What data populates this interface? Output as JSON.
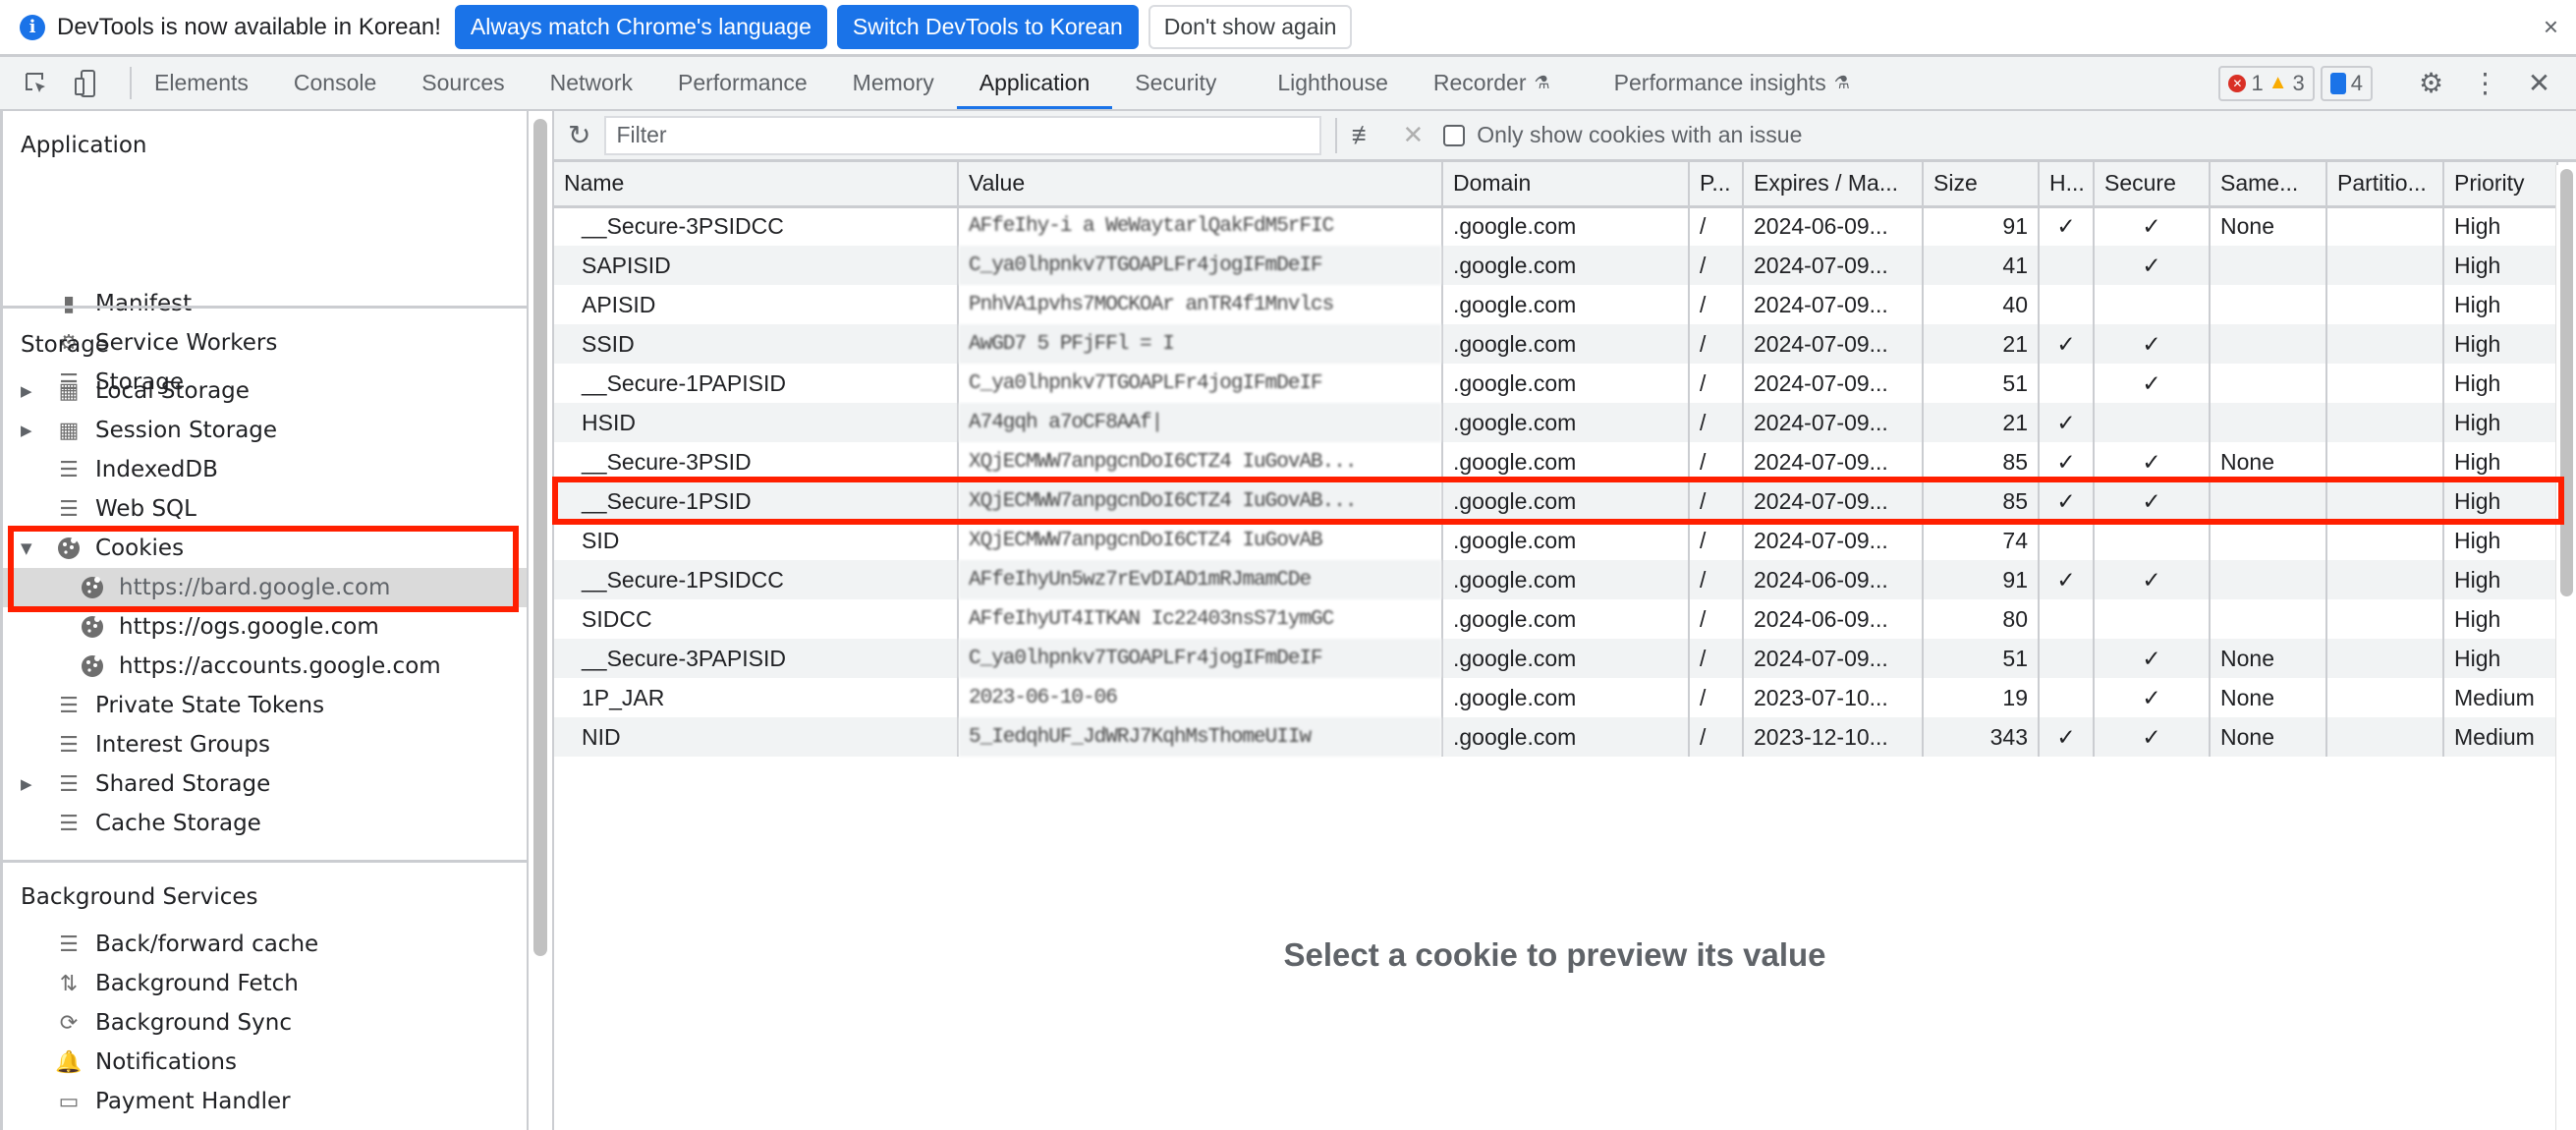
{
  "infobar": {
    "icon": "info-icon",
    "message": "DevTools is now available in Korean!",
    "buttons": [
      "Always match Chrome's language",
      "Switch DevTools to Korean",
      "Don't show again"
    ],
    "close": "×"
  },
  "tabs": [
    "Elements",
    "Console",
    "Sources",
    "Network",
    "Performance",
    "Memory",
    "Application",
    "Security",
    "Lighthouse",
    "Recorder",
    "Performance insights"
  ],
  "active_tab": "Application",
  "issues": {
    "errors": "1",
    "warnings": "3",
    "messages": "4"
  },
  "sidebar": {
    "application_heading": "Application",
    "application_items": [
      "Manifest",
      "Service Workers",
      "Storage"
    ],
    "storage_heading": "Storage",
    "storage_items": [
      "Local Storage",
      "Session Storage",
      "IndexedDB",
      "Web SQL",
      "Cookies",
      "https://bard.google.com",
      "https://ogs.google.com",
      "https://accounts.google.com",
      "Private State Tokens",
      "Interest Groups",
      "Shared Storage",
      "Cache Storage"
    ],
    "background_heading": "Background Services",
    "background_items": [
      "Back/forward cache",
      "Background Fetch",
      "Background Sync",
      "Notifications",
      "Payment Handler"
    ],
    "selected": "https://bard.google.com"
  },
  "toolbar": {
    "filter_placeholder": "Filter",
    "only_issues_label": "Only show cookies with an issue",
    "only_issues_checked": false
  },
  "table": {
    "columns": [
      "Name",
      "Value",
      "Domain",
      "P...",
      "Expires / Ma...",
      "Size",
      "H...",
      "Secure",
      "Same...",
      "Partitio...",
      "Priority"
    ],
    "rows": [
      [
        "__Secure-3PSIDCC",
        "AFfeIhy-i a WeWaytarlQakFdM5rFIC",
        ".google.com",
        "/",
        "2024-06-09...",
        "91",
        "✓",
        "✓",
        "None",
        "",
        "High"
      ],
      [
        "SAPISID",
        "C_ya0lhpnkv7TGOAPLFr4jogIFmDeIF",
        ".google.com",
        "/",
        "2024-07-09...",
        "41",
        "",
        "✓",
        "",
        "",
        "High"
      ],
      [
        "APISID",
        "PnhVA1pvhs7MOCKOAr anTR4f1Mnvlcs",
        ".google.com",
        "/",
        "2024-07-09...",
        "40",
        "",
        "",
        "",
        "",
        "High"
      ],
      [
        "SSID",
        "AwGD7 5 PFjFFl = I",
        ".google.com",
        "/",
        "2024-07-09...",
        "21",
        "✓",
        "✓",
        "",
        "",
        "High"
      ],
      [
        "__Secure-1PAPISID",
        "C_ya0lhpnkv7TGOAPLFr4jogIFmDeIF",
        ".google.com",
        "/",
        "2024-07-09...",
        "51",
        "",
        "✓",
        "",
        "",
        "High"
      ],
      [
        "HSID",
        "A74gqh a7oCF8AAf|",
        ".google.com",
        "/",
        "2024-07-09...",
        "21",
        "✓",
        "",
        "",
        "",
        "High"
      ],
      [
        "__Secure-3PSID",
        "XQjECMWW7anpgcnDoI6CTZ4 IuGovAB...",
        ".google.com",
        "/",
        "2024-07-09...",
        "85",
        "✓",
        "✓",
        "None",
        "",
        "High"
      ],
      [
        "__Secure-1PSID",
        "XQjECMWW7anpgcnDoI6CTZ4 IuGovAB...",
        ".google.com",
        "/",
        "2024-07-09...",
        "85",
        "✓",
        "✓",
        "",
        "",
        "High"
      ],
      [
        "SID",
        "XQjECMWW7anpgcnDoI6CTZ4 IuGovAB",
        ".google.com",
        "/",
        "2024-07-09...",
        "74",
        "",
        "",
        "",
        "",
        "High"
      ],
      [
        "__Secure-1PSIDCC",
        "AFfeIhyUn5wz7rEvDIAD1mRJmamCDe",
        ".google.com",
        "/",
        "2024-06-09...",
        "91",
        "✓",
        "✓",
        "",
        "",
        "High"
      ],
      [
        "SIDCC",
        "AFfeIhyUT4ITKAN Ic22403nsS71ymGC",
        ".google.com",
        "/",
        "2024-06-09...",
        "80",
        "",
        "",
        "",
        "",
        "High"
      ],
      [
        "__Secure-3PAPISID",
        "C_ya0lhpnkv7TGOAPLFr4jogIFmDeIF",
        ".google.com",
        "/",
        "2024-07-09...",
        "51",
        "",
        "✓",
        "None",
        "",
        "High"
      ],
      [
        "1P_JAR",
        "2023-06-10-06",
        ".google.com",
        "/",
        "2023-07-10...",
        "19",
        "",
        "✓",
        "None",
        "",
        "Medium"
      ],
      [
        "NID",
        "5_IedqhUF_JdWRJ7KqhMsThomeUIIw",
        ".google.com",
        "/",
        "2023-12-10...",
        "343",
        "✓",
        "✓",
        "None",
        "",
        "Medium"
      ]
    ],
    "highlighted_row": "__Secure-1PSID"
  },
  "preview_message": "Select a cookie to preview its value",
  "colors": {
    "accent": "#1a73e8",
    "highlight_box": "#ff1f00",
    "error": "#d93025",
    "warning": "#f9ab00"
  }
}
